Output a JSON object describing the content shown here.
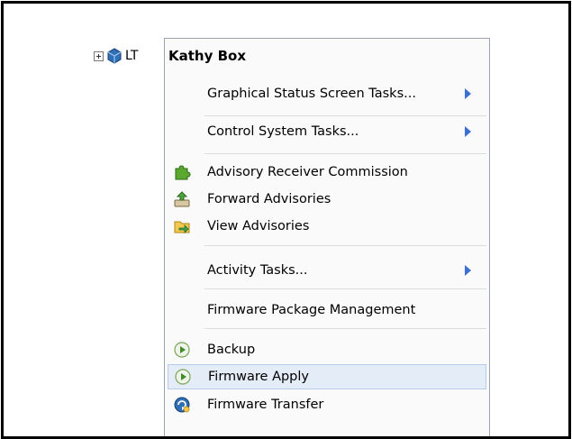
{
  "tree": {
    "node_label": "LT",
    "expander_icon": "plus-expander-icon",
    "node_icon": "device-icon"
  },
  "menu": {
    "header": "Kathy Box",
    "items": [
      {
        "label": "Graphical Status Screen Tasks...",
        "submenu": true
      },
      {
        "label": "Control System Tasks...",
        "submenu": true
      },
      {
        "label": "Advisory Receiver Commission",
        "icon": "puzzle-icon"
      },
      {
        "label": "Forward Advisories",
        "icon": "forward-icon"
      },
      {
        "label": "View Advisories",
        "icon": "folder-arrow-icon"
      },
      {
        "label": "Activity Tasks...",
        "submenu": true
      },
      {
        "label": "Firmware Package Management"
      },
      {
        "label": "Backup",
        "icon": "play-circle-icon"
      },
      {
        "label": "Firmware Apply",
        "icon": "play-circle-icon",
        "highlighted": true
      },
      {
        "label": "Firmware Transfer",
        "icon": "refresh-icon"
      }
    ]
  },
  "colors": {
    "submenu_arrow": "#3c6fd6",
    "highlight_bg": "#e4ecf8",
    "highlight_border": "#b8cbe8"
  }
}
